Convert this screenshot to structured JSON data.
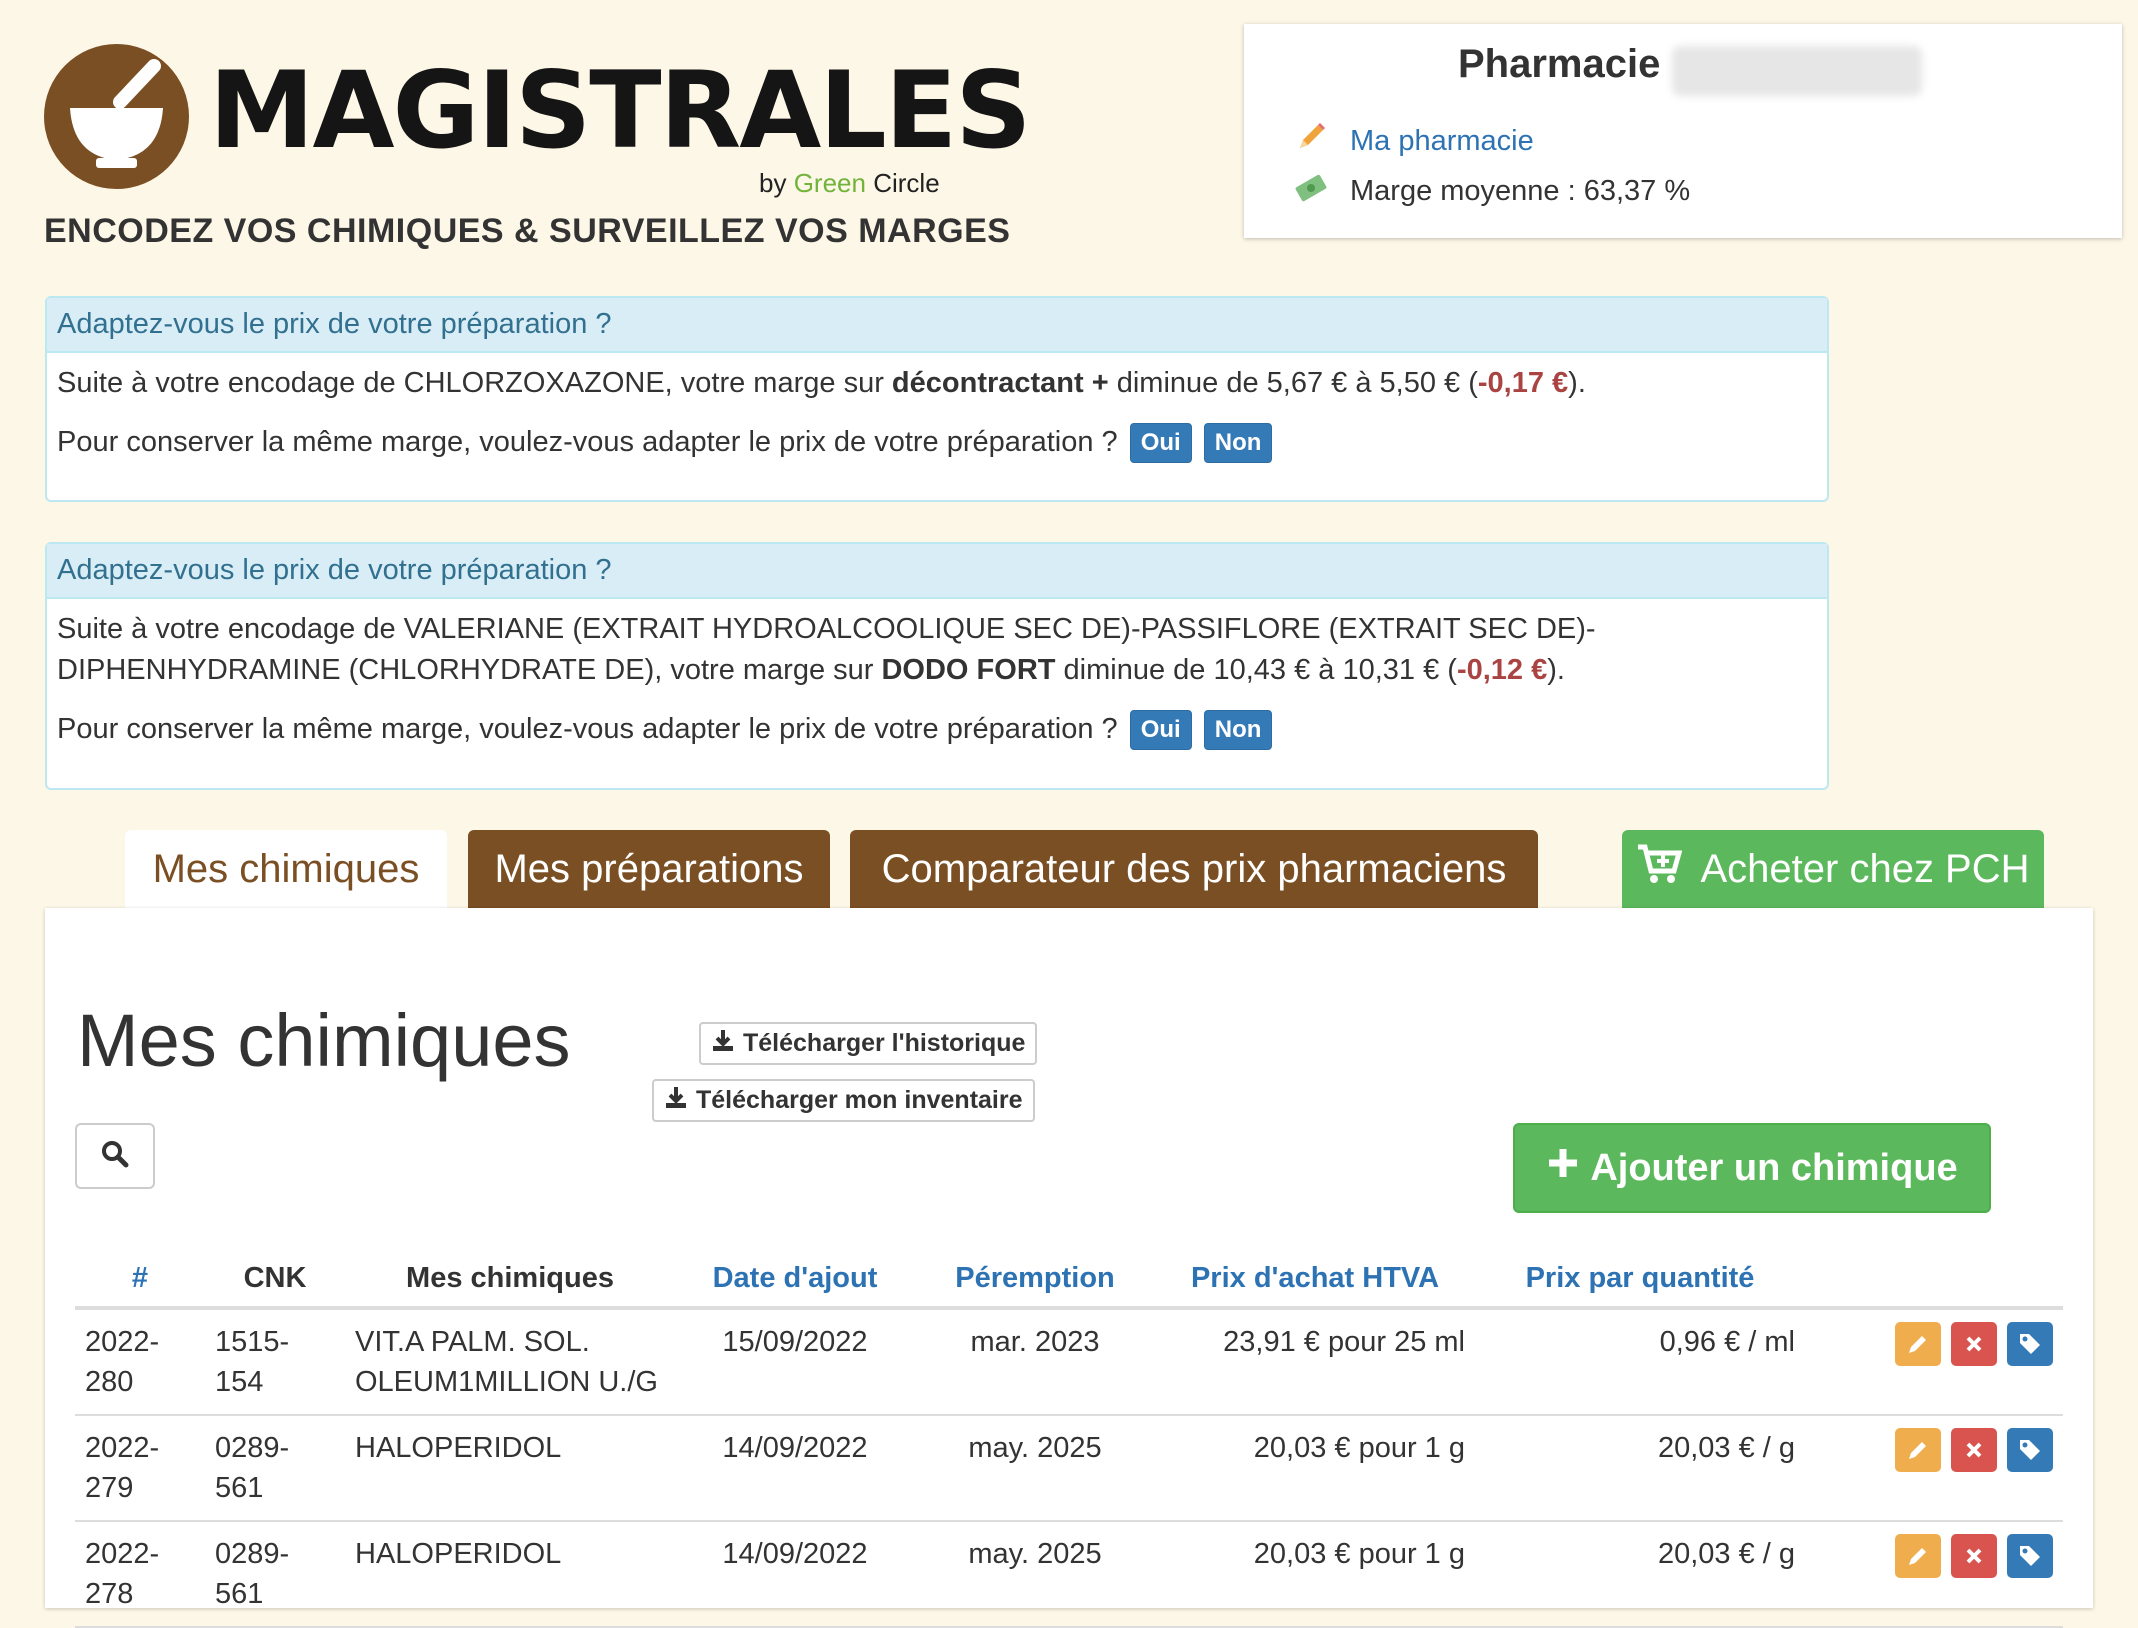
{
  "logo": {
    "wordmark": "MAGISTRALES",
    "by": "by",
    "brand_green": "Green",
    "brand_dark": "Circle"
  },
  "tagline": "ENCODEZ VOS CHIMIQUES & SURVEILLEZ VOS MARGES",
  "pharmacy": {
    "title": "Pharmacie",
    "link_label": "Ma pharmacie",
    "margin_text": "Marge moyenne : 63,37 %"
  },
  "alerts": [
    {
      "header": "Adaptez-vous le prix de votre préparation ?",
      "pre": "Suite à votre encodage de CHLORZOXAZONE, votre marge sur ",
      "product": "décontractant +",
      "mid": " diminue de 5,67 € à 5,50 € (",
      "delta": "-0,17 €",
      "post": ").",
      "question": "Pour conserver la même marge, voulez-vous adapter le prix de votre préparation ?",
      "yes": "Oui",
      "no": "Non"
    },
    {
      "header": "Adaptez-vous le prix de votre préparation ?",
      "pre": "Suite à votre encodage de VALERIANE (EXTRAIT HYDROALCOOLIQUE SEC DE)-PASSIFLORE (EXTRAIT SEC DE)-DIPHENHYDRAMINE (CHLORHYDRATE DE), votre marge sur ",
      "product": "DODO FORT",
      "mid": " diminue de 10,43 € à 10,31 € (",
      "delta": "-0,12 €",
      "post": ").",
      "question": "Pour conserver la même marge, voulez-vous adapter le prix de votre préparation ?",
      "yes": "Oui",
      "no": "Non"
    }
  ],
  "tabs": [
    "Mes chimiques",
    "Mes préparations",
    "Comparateur des prix pharmaciens"
  ],
  "buy_button": "Acheter chez PCH",
  "main": {
    "title": "Mes chimiques",
    "download_history": "Télécharger l'historique",
    "download_inventory": "Télécharger mon inventaire",
    "add_button": "Ajouter un chimique"
  },
  "table": {
    "headers": [
      "#",
      "CNK",
      "Mes chimiques",
      "Date d'ajout",
      "Péremption",
      "Prix d'achat HTVA",
      "Prix par quantité"
    ],
    "rows": [
      [
        "2022-280",
        "1515-154",
        "VIT.A PALM. SOL. OLEUM1MILLION U./G",
        "15/09/2022",
        "mar. 2023",
        "23,91 € pour 25 ml",
        "0,96 € / ml"
      ],
      [
        "2022-279",
        "0289-561",
        "HALOPERIDOL",
        "14/09/2022",
        "may. 2025",
        "20,03 € pour 1 g",
        "20,03 € / g"
      ],
      [
        "2022-278",
        "0289-561",
        "HALOPERIDOL",
        "14/09/2022",
        "may. 2025",
        "20,03 € pour 1 g",
        "20,03 € / g"
      ]
    ]
  },
  "colors": {
    "background": "#fdf7e7",
    "brown": "#7b4f24",
    "green": "#5cb85c",
    "link": "#2d72b3",
    "danger": "#d9534f",
    "warning": "#f0ad4e",
    "primary": "#337ab7"
  },
  "icons": [
    "mortar-logo-icon",
    "pencil-icon",
    "money-icon",
    "cart-plus-icon",
    "download-icon",
    "search-icon",
    "plus-icon",
    "edit-icon",
    "delete-icon",
    "tag-icon"
  ]
}
